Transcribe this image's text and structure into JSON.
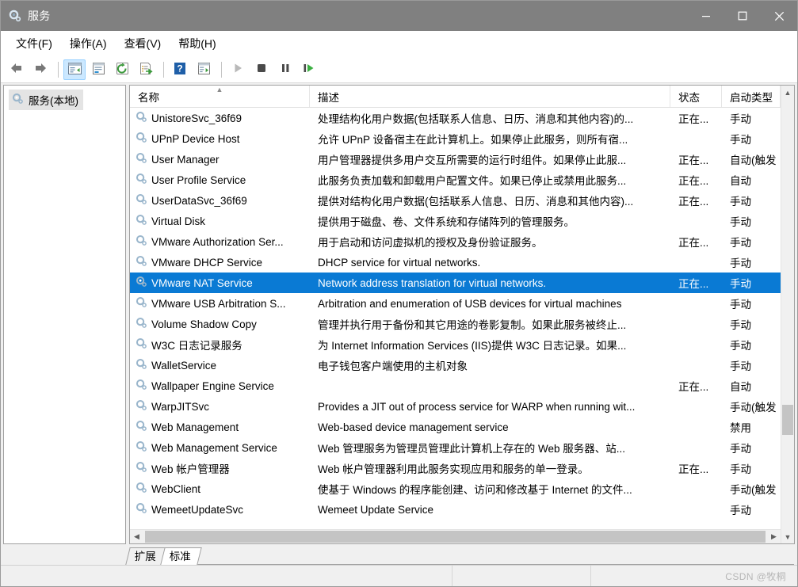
{
  "window": {
    "title": "服务",
    "title_icon": "services-gear-icon",
    "minimize_label": "最小化",
    "maximize_label": "最大化",
    "close_label": "关闭"
  },
  "menubar": [
    {
      "label": "文件(F)",
      "name": "menu-file"
    },
    {
      "label": "操作(A)",
      "name": "menu-action"
    },
    {
      "label": "查看(V)",
      "name": "menu-view"
    },
    {
      "label": "帮助(H)",
      "name": "menu-help"
    }
  ],
  "toolbar": [
    {
      "name": "back-button",
      "icon": "arrow-left-icon"
    },
    {
      "name": "forward-button",
      "icon": "arrow-right-icon"
    },
    {
      "sep": true
    },
    {
      "name": "show-hide-console-tree-button",
      "icon": "console-tree-icon",
      "active": true
    },
    {
      "sep": false,
      "name": "properties-button",
      "icon": "properties-icon"
    },
    {
      "name": "refresh-button",
      "icon": "refresh-icon"
    },
    {
      "name": "export-list-button",
      "icon": "export-list-icon"
    },
    {
      "sep": true
    },
    {
      "name": "help-button",
      "icon": "help-icon"
    },
    {
      "name": "show-action-pane-button",
      "icon": "action-pane-icon"
    },
    {
      "sep": true
    },
    {
      "name": "start-service-button",
      "icon": "play-icon"
    },
    {
      "name": "stop-service-button",
      "icon": "stop-icon"
    },
    {
      "name": "pause-service-button",
      "icon": "pause-icon"
    },
    {
      "name": "restart-service-button",
      "icon": "restart-icon"
    }
  ],
  "sidebar": {
    "root_label": "服务(本地)",
    "root_icon": "services-gear-icon"
  },
  "columns": [
    {
      "key": "name",
      "label": "名称",
      "sorted": "asc"
    },
    {
      "key": "desc",
      "label": "描述"
    },
    {
      "key": "status",
      "label": "状态"
    },
    {
      "key": "start",
      "label": "启动类型"
    }
  ],
  "rows": [
    {
      "name": "UnistoreSvc_36f69",
      "desc": "处理结构化用户数据(包括联系人信息、日历、消息和其他内容)的...",
      "status": "正在...",
      "start": "手动"
    },
    {
      "name": "UPnP Device Host",
      "desc": "允许 UPnP 设备宿主在此计算机上。如果停止此服务，则所有宿...",
      "status": "",
      "start": "手动"
    },
    {
      "name": "User Manager",
      "desc": "用户管理器提供多用户交互所需要的运行时组件。如果停止此服...",
      "status": "正在...",
      "start": "自动(触发"
    },
    {
      "name": "User Profile Service",
      "desc": "此服务负责加载和卸载用户配置文件。如果已停止或禁用此服务...",
      "status": "正在...",
      "start": "自动"
    },
    {
      "name": "UserDataSvc_36f69",
      "desc": "提供对结构化用户数据(包括联系人信息、日历、消息和其他内容)...",
      "status": "正在...",
      "start": "手动"
    },
    {
      "name": "Virtual Disk",
      "desc": "提供用于磁盘、卷、文件系统和存储阵列的管理服务。",
      "status": "",
      "start": "手动"
    },
    {
      "name": "VMware Authorization Ser...",
      "desc": "用于启动和访问虚拟机的授权及身份验证服务。",
      "status": "正在...",
      "start": "手动"
    },
    {
      "name": "VMware DHCP Service",
      "desc": "DHCP service for virtual networks.",
      "status": "",
      "start": "手动"
    },
    {
      "name": "VMware NAT Service",
      "desc": "Network address translation for virtual networks.",
      "status": "正在...",
      "start": "手动",
      "selected": true
    },
    {
      "name": "VMware USB Arbitration S...",
      "desc": "Arbitration and enumeration of USB devices for virtual machines",
      "status": "",
      "start": "手动"
    },
    {
      "name": "Volume Shadow Copy",
      "desc": "管理并执行用于备份和其它用途的卷影复制。如果此服务被终止...",
      "status": "",
      "start": "手动"
    },
    {
      "name": "W3C 日志记录服务",
      "desc": "为 Internet Information Services (IIS)提供 W3C 日志记录。如果...",
      "status": "",
      "start": "手动"
    },
    {
      "name": "WalletService",
      "desc": "电子钱包客户端使用的主机对象",
      "status": "",
      "start": "手动"
    },
    {
      "name": "Wallpaper Engine Service",
      "desc": "",
      "status": "正在...",
      "start": "自动"
    },
    {
      "name": "WarpJITSvc",
      "desc": "Provides a JIT out of process service for WARP when running wit...",
      "status": "",
      "start": "手动(触发"
    },
    {
      "name": "Web Management",
      "desc": "Web-based device management service",
      "status": "",
      "start": "禁用"
    },
    {
      "name": "Web Management Service",
      "desc": "Web 管理服务为管理员管理此计算机上存在的 Web 服务器、站...",
      "status": "",
      "start": "手动"
    },
    {
      "name": "Web 帐户管理器",
      "desc": "Web 帐户管理器利用此服务实现应用和服务的单一登录。",
      "status": "正在...",
      "start": "手动"
    },
    {
      "name": "WebClient",
      "desc": "使基于 Windows 的程序能创建、访问和修改基于 Internet 的文件...",
      "status": "",
      "start": "手动(触发"
    },
    {
      "name": "WemeetUpdateSvc",
      "desc": "Wemeet Update Service",
      "status": "",
      "start": "手动"
    }
  ],
  "tabs": [
    {
      "label": "扩展",
      "name": "tab-extended",
      "active": false
    },
    {
      "label": "标准",
      "name": "tab-standard",
      "active": true
    }
  ],
  "statusbar": {
    "watermark": "CSDN @牧桐"
  },
  "colors": {
    "selection": "#0a7ad4",
    "titlebar": "#808080",
    "chrome": "#f0f0f0"
  }
}
